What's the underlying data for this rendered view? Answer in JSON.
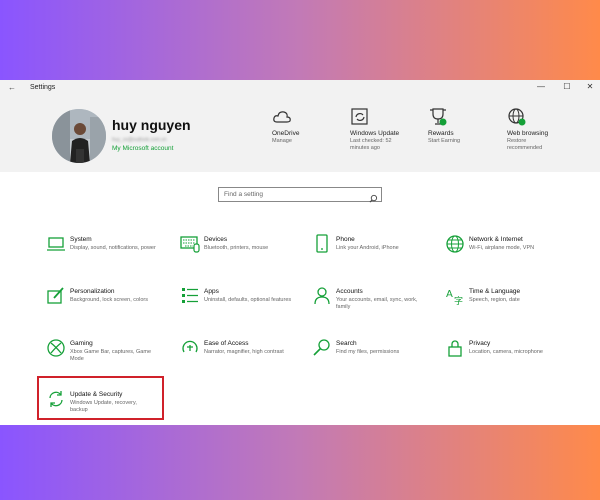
{
  "window": {
    "title": "Settings",
    "back_glyph": "←",
    "controls": {
      "minimize": "—",
      "maximize": "☐",
      "close": "✕"
    }
  },
  "profile": {
    "name": "huy nguyen",
    "email": "huy_xx@outlook.com.vn",
    "account_link": "My Microsoft account"
  },
  "quick_links": [
    {
      "title": "OneDrive",
      "subtitle": "Manage",
      "icon": "cloud-icon"
    },
    {
      "title": "Windows Update",
      "subtitle": "Last checked: 52 minutes ago",
      "icon": "sync-icon"
    },
    {
      "title": "Rewards",
      "subtitle": "Start Earning",
      "icon": "trophy-icon"
    },
    {
      "title": "Web browsing",
      "subtitle": "Restore recommended",
      "icon": "globe-icon"
    }
  ],
  "search": {
    "placeholder": "Find a setting"
  },
  "categories": [
    {
      "name": "System",
      "desc": "Display, sound, notifications, power",
      "icon": "laptop-icon"
    },
    {
      "name": "Devices",
      "desc": "Bluetooth, printers, mouse",
      "icon": "keyboard-icon"
    },
    {
      "name": "Phone",
      "desc": "Link your Android, iPhone",
      "icon": "phone-icon"
    },
    {
      "name": "Network & Internet",
      "desc": "Wi-Fi, airplane mode, VPN",
      "icon": "globe-icon"
    },
    {
      "name": "Personalization",
      "desc": "Background, lock screen, colors",
      "icon": "paint-icon"
    },
    {
      "name": "Apps",
      "desc": "Uninstall, defaults, optional features",
      "icon": "apps-list-icon"
    },
    {
      "name": "Accounts",
      "desc": "Your accounts, email, sync, work, family",
      "icon": "person-icon"
    },
    {
      "name": "Time & Language",
      "desc": "Speech, region, date",
      "icon": "time-language-icon"
    },
    {
      "name": "Gaming",
      "desc": "Xbox Game Bar, captures, Game Mode",
      "icon": "xbox-icon"
    },
    {
      "name": "Ease of Access",
      "desc": "Narrator, magnifier, high contrast",
      "icon": "ease-of-access-icon"
    },
    {
      "name": "Search",
      "desc": "Find my files, permissions",
      "icon": "search-icon"
    },
    {
      "name": "Privacy",
      "desc": "Location, camera, microphone",
      "icon": "lock-icon"
    },
    {
      "name": "Update & Security",
      "desc": "Windows Update, recovery, backup",
      "icon": "sync-icon"
    }
  ],
  "colors": {
    "accent_green": "#15a038",
    "highlight_red": "#d0212a",
    "bg_gradient_start": "#8a55ff",
    "bg_gradient_end": "#ff8a4a"
  }
}
